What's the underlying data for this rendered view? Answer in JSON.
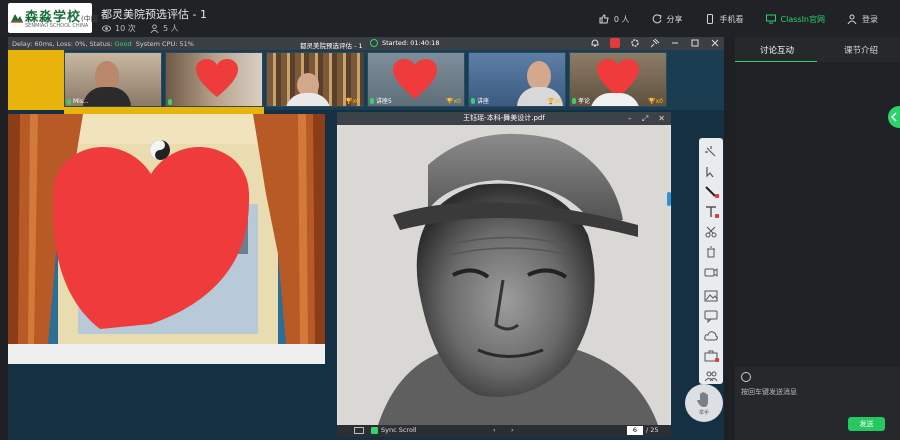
{
  "header": {
    "logo_text": "森淼学校",
    "logo_suffix": "(中国",
    "logo_sub": "SENMIAO SCHOOL CHINA",
    "course_title": "都灵美院预选评估 - 1",
    "views": "10 次",
    "people": "5 人",
    "actions": {
      "like": "0 人",
      "share": "分享",
      "mobile": "手机看",
      "site": "ClassIn官网",
      "login": "登录"
    }
  },
  "classroom": {
    "status_prefix": "Delay: 60ms, Loss: 0%, Status:",
    "status_value": "Good",
    "cpu": "System CPU: 51%",
    "window_title": "都灵美院预选评估 - 1",
    "started": "Started: 01:40:18",
    "participants": [
      {
        "name": "Mis...",
        "trophies": ""
      },
      {
        "name": "",
        "trophies": ""
      },
      {
        "name": "",
        "trophies": "x0"
      },
      {
        "name": "讲座5",
        "trophies": "x0"
      },
      {
        "name": "讲座",
        "trophies": "x0"
      },
      {
        "name": "孝论",
        "trophies": "x0"
      }
    ],
    "pdf": {
      "title": "王钰瑶-本科-舞美设计.pdf",
      "sync_label": "Sync Scroll",
      "page": "6",
      "total": "/ 25",
      "prev": "‹",
      "next": "›"
    },
    "hand_label": "举手"
  },
  "right_panel": {
    "tabs": [
      "讨论互动",
      "课节介绍"
    ],
    "placeholder": "按回车键发送消息",
    "send": "发送"
  },
  "colors": {
    "accent_green": "#2bd36a",
    "warning_yellow": "#e8b40b",
    "status_good": "#38d26b"
  }
}
